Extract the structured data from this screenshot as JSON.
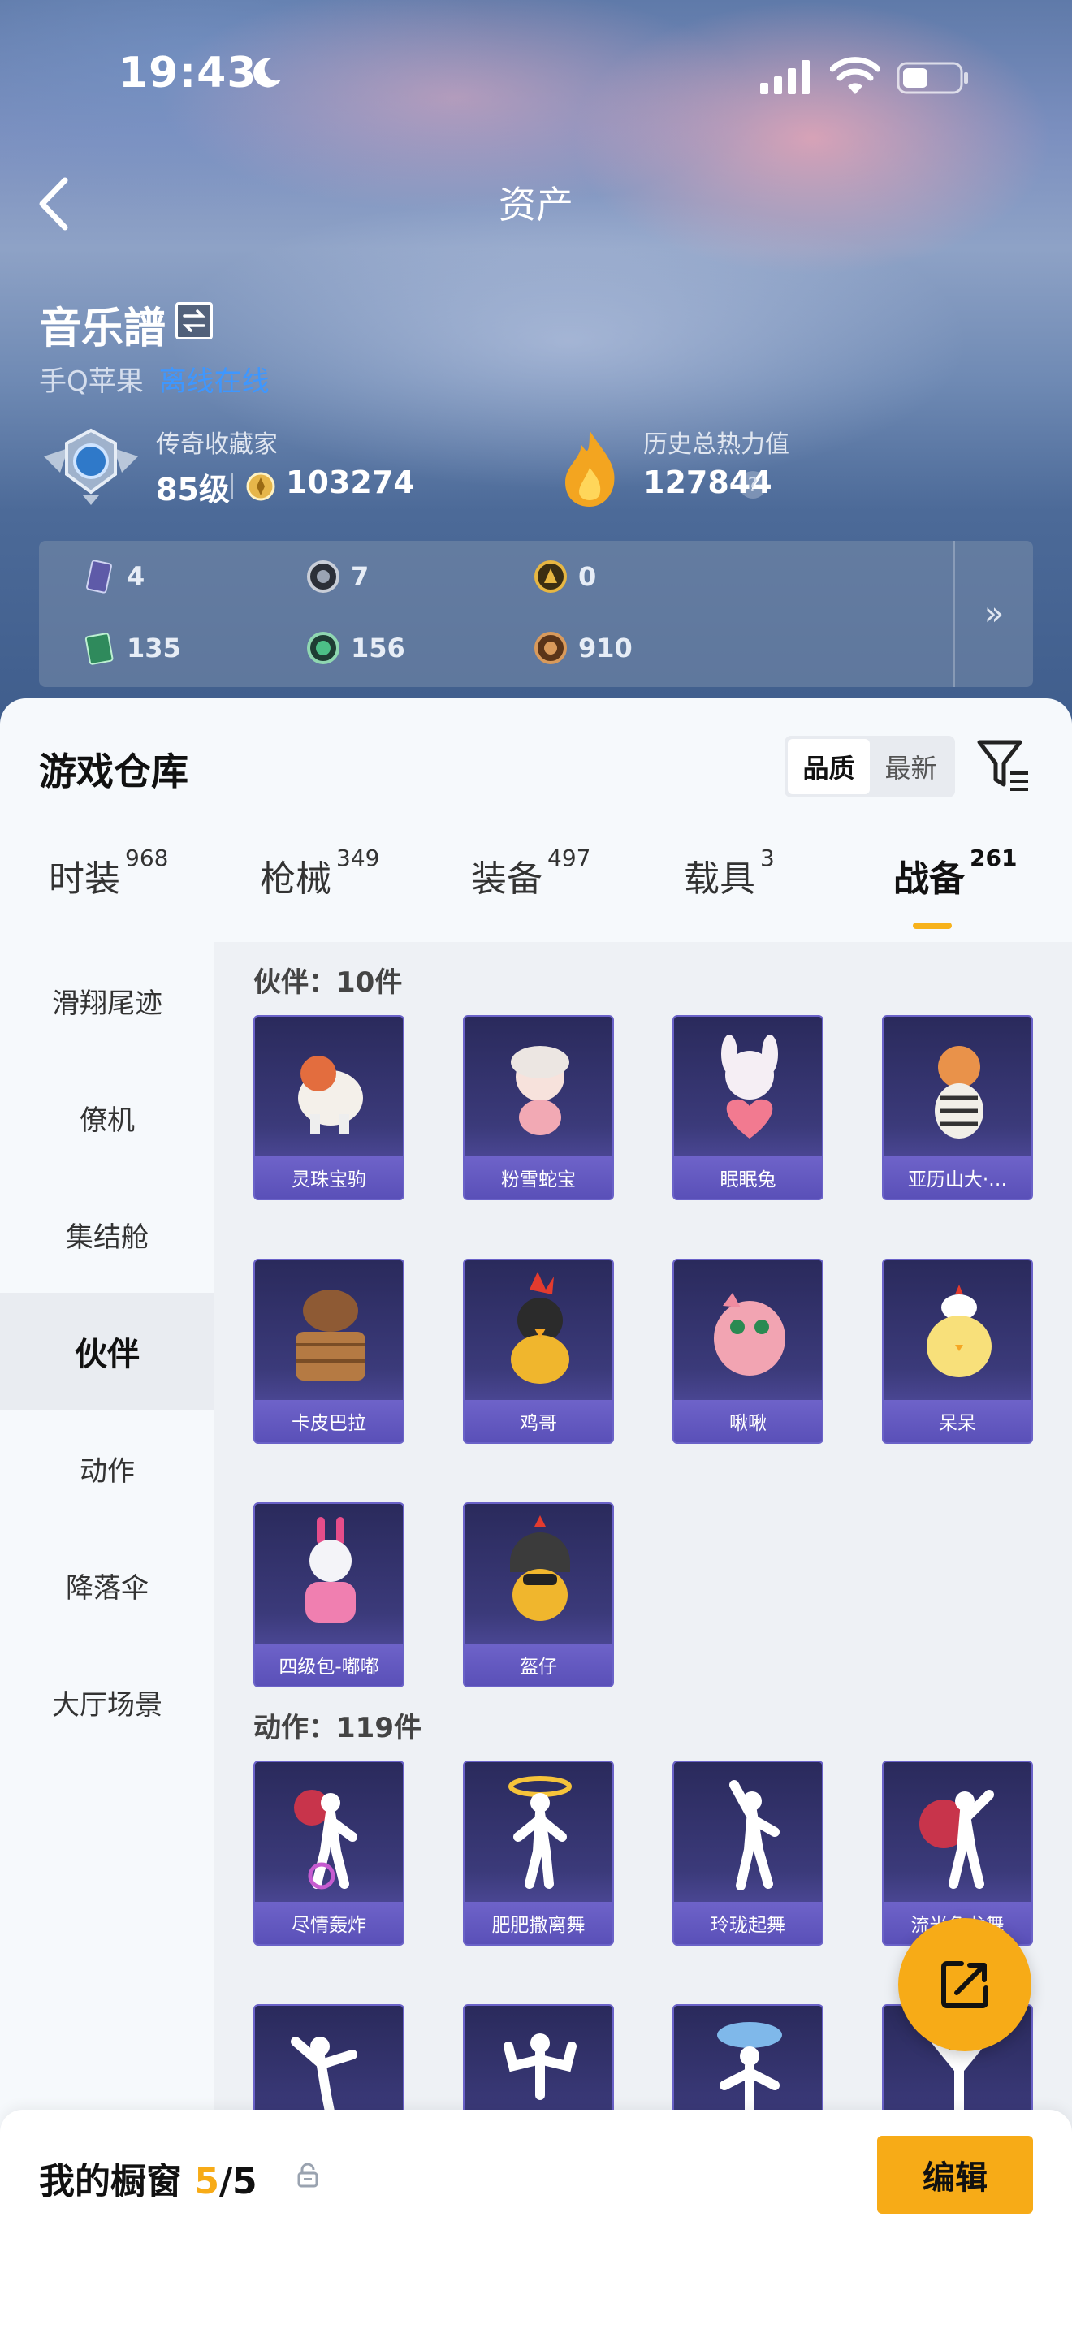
{
  "status": {
    "time": "19:43"
  },
  "nav": {
    "title": "资产"
  },
  "profile": {
    "name": "音乐譜",
    "platform": "手Q苹果",
    "status_link": "离线在线",
    "rank_label": "传奇收藏家",
    "level": "85级",
    "coins": "103274",
    "heat_label": "历史总热力值",
    "heat_value": "127844"
  },
  "currencies": [
    {
      "icon": "card-icon",
      "value": "4"
    },
    {
      "icon": "silver-coin-icon",
      "value": "7"
    },
    {
      "icon": "gold-coin-icon",
      "value": "0"
    },
    {
      "icon": "green-ticket-icon",
      "value": "135"
    },
    {
      "icon": "green-orb-icon",
      "value": "156"
    },
    {
      "icon": "bronze-coin-icon",
      "value": "910"
    }
  ],
  "warehouse": {
    "title": "游戏仓库",
    "sort": [
      "品质",
      "最新"
    ],
    "tabs": [
      {
        "label": "时装",
        "count": "968"
      },
      {
        "label": "枪械",
        "count": "349"
      },
      {
        "label": "装备",
        "count": "497"
      },
      {
        "label": "载具",
        "count": "3"
      },
      {
        "label": "战备",
        "count": "261"
      }
    ],
    "side": [
      "滑翔尾迹",
      "僚机",
      "集结舱",
      "伙伴",
      "动作",
      "降落伞",
      "大厅场景"
    ],
    "sections": [
      {
        "title": "伙伴：10件",
        "items": [
          "灵珠宝驹",
          "粉雪蛇宝",
          "眠眠兔",
          "亚历山大·…",
          "卡皮巴拉",
          "鸡哥",
          "啾啾",
          "呆呆",
          "四级包-嘟嘟",
          "盔仔"
        ]
      },
      {
        "title": "动作：119件",
        "items": [
          "尽情轰炸",
          "肥肥撒离舞",
          "玲珑起舞",
          "流光鱼龙舞",
          "",
          "",
          "",
          ""
        ]
      }
    ]
  },
  "showcase": {
    "title": "我的橱窗",
    "current": "5",
    "total": "/5",
    "edit": "编辑"
  },
  "colors": {
    "accent": "#f7ab17",
    "card": "#3b3a7a",
    "link": "#3e97ff"
  }
}
